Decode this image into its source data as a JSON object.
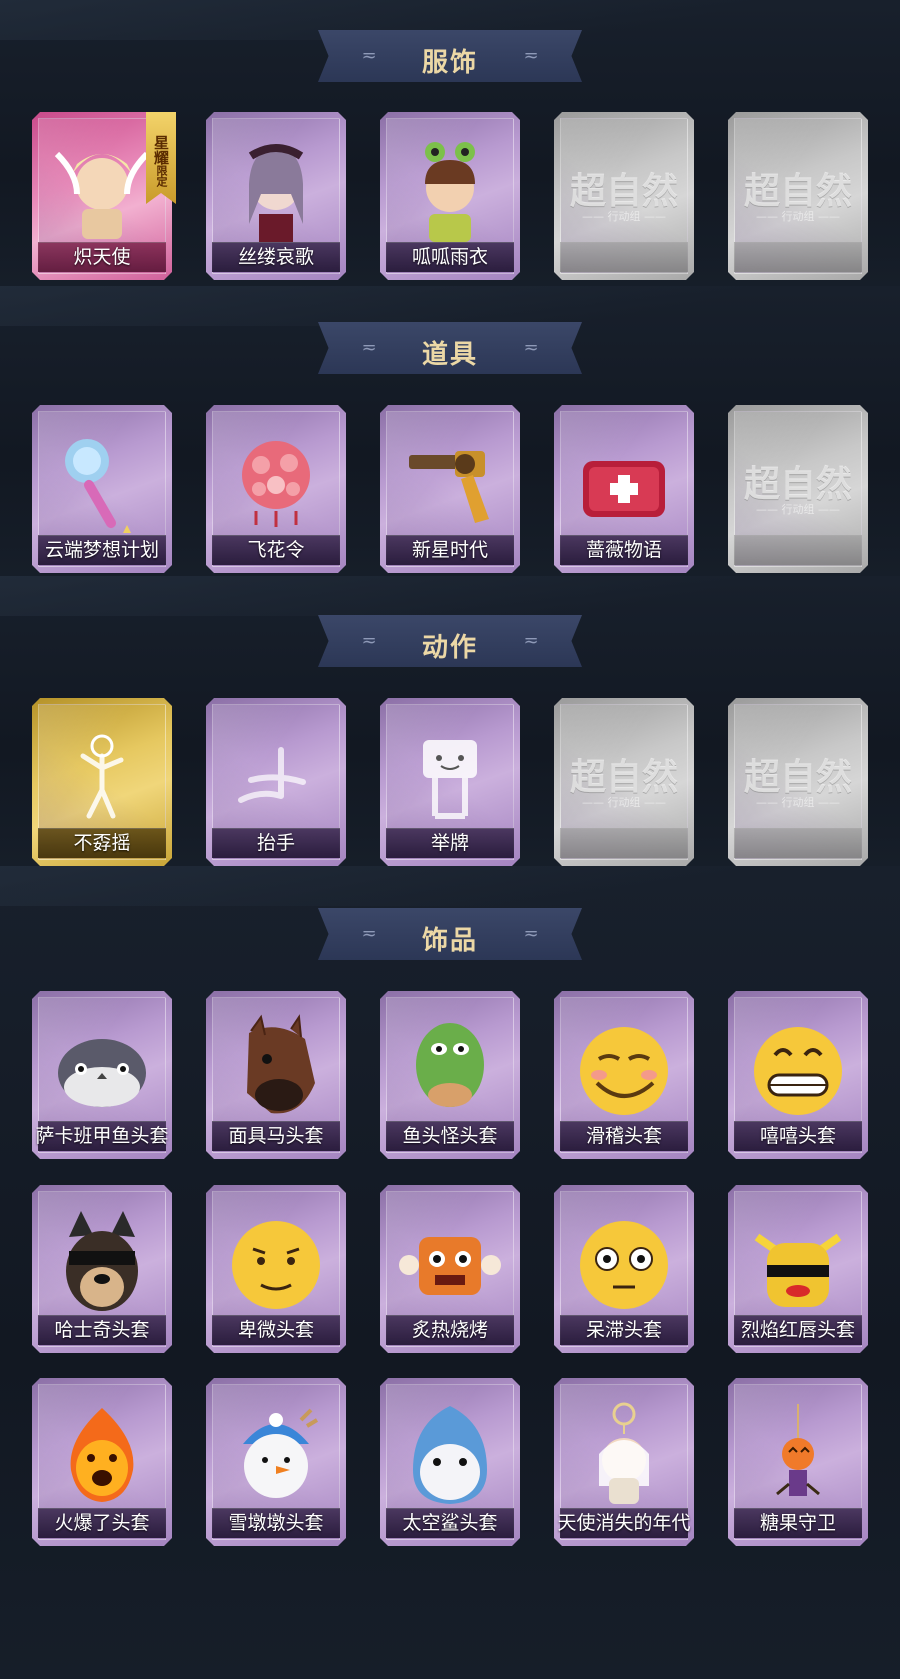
{
  "sections": [
    {
      "title": "服饰",
      "items": [
        {
          "name": "炽天使",
          "icon": "seraph-costume-icon",
          "style": "pink",
          "badge": "星耀",
          "badge_sub": "限定"
        },
        {
          "name": "丝缕哀歌",
          "icon": "lace-elegy-costume-icon",
          "style": "purple"
        },
        {
          "name": "呱呱雨衣",
          "icon": "frog-raincoat-costume-icon",
          "style": "purple"
        },
        {
          "name": "",
          "icon": "supernatural-placeholder-icon",
          "style": "empty"
        },
        {
          "name": "",
          "icon": "supernatural-placeholder-icon",
          "style": "empty"
        }
      ]
    },
    {
      "title": "道具",
      "items": [
        {
          "name": "云端梦想计划",
          "icon": "cloud-scepter-icon",
          "style": "purple"
        },
        {
          "name": "飞花令",
          "icon": "flower-lantern-icon",
          "style": "purple"
        },
        {
          "name": "新星时代",
          "icon": "revolver-icon",
          "style": "purple"
        },
        {
          "name": "蔷薇物语",
          "icon": "medkit-icon",
          "style": "purple"
        },
        {
          "name": "",
          "icon": "supernatural-placeholder-icon",
          "style": "empty"
        }
      ]
    },
    {
      "title": "动作",
      "items": [
        {
          "name": "不孬摇",
          "icon": "dance-emote-icon",
          "style": "gold"
        },
        {
          "name": "抬手",
          "icon": "raise-hand-emote-icon",
          "style": "purple"
        },
        {
          "name": "举牌",
          "icon": "hold-sign-emote-icon",
          "style": "purple"
        },
        {
          "name": "",
          "icon": "supernatural-placeholder-icon",
          "style": "empty"
        },
        {
          "name": "",
          "icon": "supernatural-placeholder-icon",
          "style": "empty"
        }
      ]
    },
    {
      "title": "饰品",
      "items": [
        {
          "name": "萨卡班甲鱼头套",
          "icon": "sacabambaspis-mask-icon",
          "style": "purple"
        },
        {
          "name": "面具马头套",
          "icon": "horse-mask-icon",
          "style": "purple"
        },
        {
          "name": "鱼头怪头套",
          "icon": "fish-head-mask-icon",
          "style": "purple"
        },
        {
          "name": "滑稽头套",
          "icon": "funny-face-mask-icon",
          "style": "purple"
        },
        {
          "name": "嘻嘻头套",
          "icon": "grin-mask-icon",
          "style": "purple"
        },
        {
          "name": "哈士奇头套",
          "icon": "husky-mask-icon",
          "style": "purple"
        },
        {
          "name": "卑微头套",
          "icon": "humble-face-mask-icon",
          "style": "purple"
        },
        {
          "name": "炙热烧烤",
          "icon": "bbq-meat-mask-icon",
          "style": "purple"
        },
        {
          "name": "呆滞头套",
          "icon": "dazed-face-mask-icon",
          "style": "purple"
        },
        {
          "name": "烈焰红唇头套",
          "icon": "pikachu-lips-mask-icon",
          "style": "purple"
        },
        {
          "name": "火爆了头套",
          "icon": "fire-spirit-mask-icon",
          "style": "purple"
        },
        {
          "name": "雪墩墩头套",
          "icon": "snowman-mask-icon",
          "style": "purple"
        },
        {
          "name": "太空鲨头套",
          "icon": "space-shark-mask-icon",
          "style": "purple"
        },
        {
          "name": "天使消失的年代",
          "icon": "vanished-angel-pendant-icon",
          "style": "purple"
        },
        {
          "name": "糖果守卫",
          "icon": "candy-guard-pendant-icon",
          "style": "purple"
        }
      ]
    }
  ],
  "placeholder": {
    "logo": "超自然",
    "sub": "—— 行动组 ——"
  },
  "colors": {
    "background": "#141a24",
    "header_ribbon": "#34406a",
    "header_text": "#ecd8a6",
    "card_purple": "#b89ad0",
    "card_gold": "#e6c860",
    "card_pink": "#e888b8",
    "card_empty": "#c8c8c8"
  }
}
